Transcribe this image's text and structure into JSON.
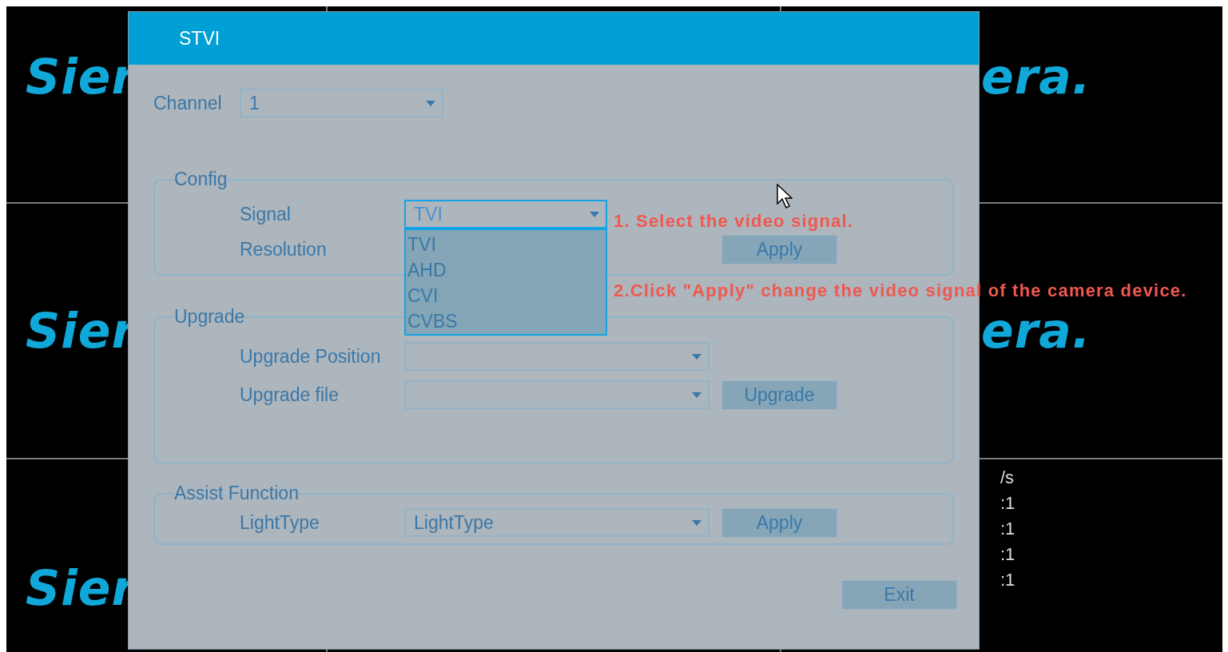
{
  "tiles": [
    {
      "kind": "logo",
      "text": "Sier"
    },
    {
      "kind": "blank"
    },
    {
      "kind": "logo",
      "text": "era."
    },
    {
      "kind": "logo",
      "text": "Sier"
    },
    {
      "kind": "blank"
    },
    {
      "kind": "logo",
      "text": "era."
    },
    {
      "kind": "logo",
      "text": "Sier"
    },
    {
      "kind": "blank"
    },
    {
      "kind": "stats",
      "lines": [
        "/s",
        ":1",
        ":1",
        ":1",
        ":1"
      ]
    }
  ],
  "dialog": {
    "title": "STVI",
    "channel": {
      "label": "Channel",
      "value": "1"
    },
    "config": {
      "legend": "Config",
      "signal": {
        "label": "Signal",
        "value": "TVI",
        "expanded": true,
        "options": [
          "TVI",
          "AHD",
          "CVI",
          "CVBS"
        ]
      },
      "resolution": {
        "label": "Resolution"
      },
      "apply": "Apply"
    },
    "upgrade": {
      "legend": "Upgrade",
      "position": {
        "label": "Upgrade Position"
      },
      "file": {
        "label": "Upgrade file"
      },
      "button": "Upgrade"
    },
    "assist": {
      "legend": "Assist Function",
      "light_type": {
        "label": "LightType",
        "value": "LightType"
      },
      "apply": "Apply"
    },
    "exit": "Exit"
  },
  "annotations": [
    "1. Select the video signal.",
    "2.Click \"Apply\" change the video signal of the camera device."
  ]
}
